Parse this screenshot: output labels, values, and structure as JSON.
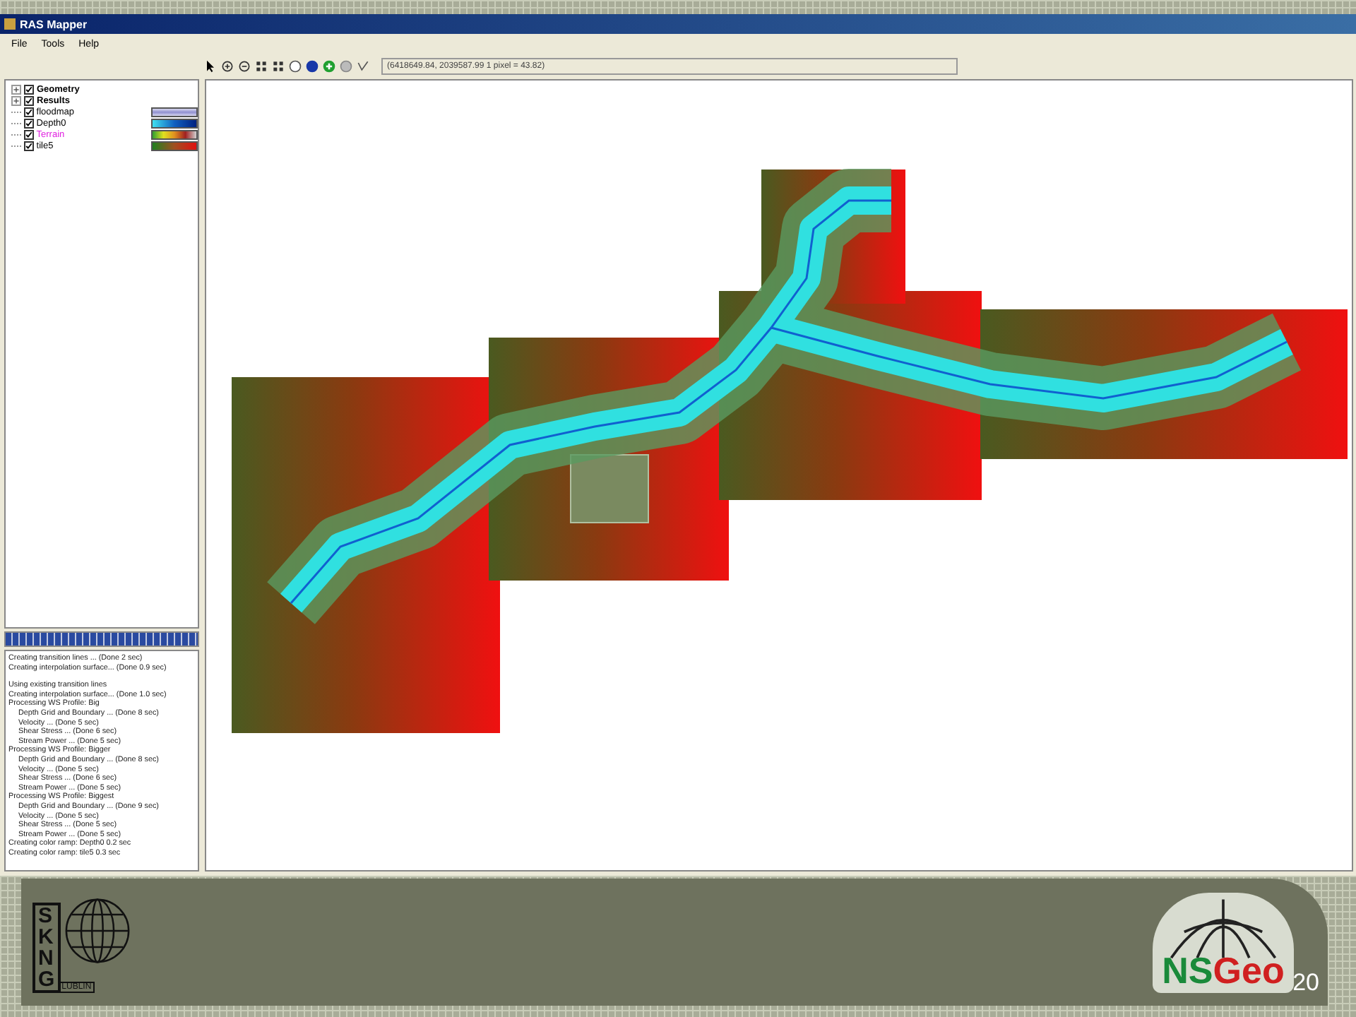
{
  "window": {
    "title": "RAS Mapper"
  },
  "menu": [
    "File",
    "Tools",
    "Help"
  ],
  "toolbar": {
    "coordinates": "(6418649.84, 2039587.99 1 pixel = 43.82)"
  },
  "layers": [
    {
      "name": "Geometry",
      "kind": "group",
      "checked": true,
      "expanded": false,
      "selected": false
    },
    {
      "name": "Results",
      "kind": "group",
      "checked": true,
      "expanded": false,
      "selected": false
    },
    {
      "name": "floodmap",
      "kind": "floodmap",
      "checked": true,
      "selected": false
    },
    {
      "name": "Depth0",
      "kind": "depth",
      "checked": true,
      "selected": false
    },
    {
      "name": "Terrain",
      "kind": "terrain",
      "checked": true,
      "selected": true
    },
    {
      "name": "tile5",
      "kind": "elevation",
      "checked": true,
      "selected": false
    }
  ],
  "progress": {
    "level": 1
  },
  "log": [
    {
      "text": "Creating transition lines ... (Done 2 sec)",
      "indent": false
    },
    {
      "text": "Creating interpolation surface... (Done 0.9 sec)",
      "indent": false
    },
    {
      "text": "Using existing transition lines",
      "indent": false,
      "gap": true
    },
    {
      "text": "Creating interpolation surface... (Done 1.0 sec)",
      "indent": false
    },
    {
      "text": "Processing WS Profile: Big",
      "indent": false
    },
    {
      "text": "Depth Grid and Boundary ... (Done 8 sec)",
      "indent": true
    },
    {
      "text": "Velocity ... (Done 5 sec)",
      "indent": true
    },
    {
      "text": "Shear Stress ... (Done 6 sec)",
      "indent": true
    },
    {
      "text": "Stream Power ... (Done 5 sec)",
      "indent": true
    },
    {
      "text": "Processing WS Profile: Bigger",
      "indent": false
    },
    {
      "text": "Depth Grid and Boundary ... (Done 8 sec)",
      "indent": true
    },
    {
      "text": "Velocity ... (Done 5 sec)",
      "indent": true
    },
    {
      "text": "Shear Stress ... (Done 6 sec)",
      "indent": true
    },
    {
      "text": "Stream Power ... (Done 5 sec)",
      "indent": true
    },
    {
      "text": "Processing WS Profile: Biggest",
      "indent": false
    },
    {
      "text": "Depth Grid and Boundary ... (Done 9 sec)",
      "indent": true
    },
    {
      "text": "Velocity ... (Done 5 sec)",
      "indent": true
    },
    {
      "text": "Shear Stress ... (Done 5 sec)",
      "indent": true
    },
    {
      "text": "Stream Power ... (Done 5 sec)",
      "indent": true
    },
    {
      "text": "Creating color ramp: Depth0 0.2 sec",
      "indent": false
    },
    {
      "text": "Creating color ramp: tile5 0.3 sec",
      "indent": false
    }
  ],
  "footer": {
    "left_logo": {
      "letters": [
        "S",
        "K",
        "N",
        "G"
      ],
      "sub": "LUBLIN"
    },
    "right_logo": {
      "part1": "NS",
      "part2": "Geo"
    },
    "page_number": "20"
  }
}
